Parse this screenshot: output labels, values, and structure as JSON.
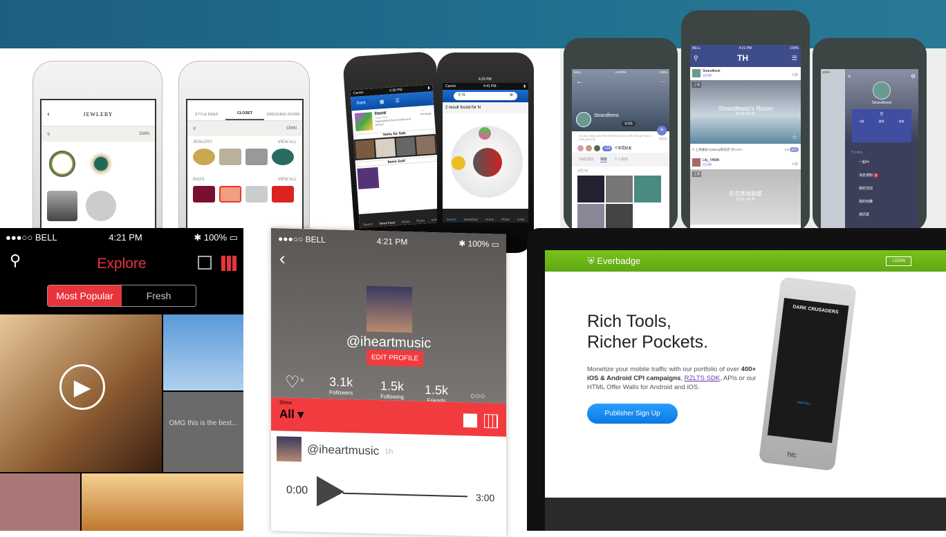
{
  "jewelry_app": {
    "screen1": {
      "title": "JEWLERY",
      "search_filter": "OWN"
    },
    "screen2": {
      "tabs": [
        "STYLE FEED",
        "CLOSET",
        "DRESSING ROOM"
      ],
      "active_tab": "CLOSET",
      "search_filter": "OWN",
      "sections": [
        {
          "label": "JEWLERY",
          "action": "VIEW ALL"
        },
        {
          "label": "BAGS",
          "action": "VIEW ALL"
        }
      ]
    }
  },
  "marketplace_app": {
    "screen1": {
      "carrier": "Carrier",
      "time": "4:36 PM",
      "back": "Back",
      "user_name": "David",
      "user_role": "Sales Rep",
      "user_quote": "Guaranteed best service and prices!",
      "message": "message",
      "items_for_sale": "Items for Sale",
      "items_sold": "Items Sold",
      "tabs": [
        "Search",
        "News Feed",
        "Home",
        "Photo",
        "smily"
      ]
    },
    "screen2": {
      "carrier": "Carrier",
      "time": "4:41 PM",
      "time_outer": "4:25 PM",
      "search_value": "N",
      "result_text": "2 result found for N",
      "tabs": [
        "Search",
        "Newsfeed",
        "Home",
        "Photo",
        "smily"
      ]
    }
  },
  "social_cn_app": {
    "screen1": {
      "carrier": "BELL",
      "time": "4:21PM",
      "battery": "100%",
      "name": "Strandfeest",
      "send_message": "发消息",
      "bio": "As you step over the threshold,you will change into a new person!",
      "add_friend": "加好友",
      "mutual_count": "+24",
      "mutual_label": "个共同好友",
      "tabs": [
        "TA的活动",
        "相册",
        "个人资料"
      ],
      "active_tab": "相册",
      "date": "3月7日"
    },
    "screen2": {
      "carrier": "BELL",
      "time": "4:21 PM",
      "battery": "100%",
      "logo": "TH",
      "posts": [
        {
          "user": "Strandfeest",
          "time": "3分钟",
          "tag": "K歌",
          "city": "上海",
          "room": "Strandfeest's Room",
          "hours": "15:30~21:30",
          "location": "上海嘉城 GalaCity假日店",
          "distance": "距5.9km",
          "count_a": "3",
          "count_b": "5",
          "join": "2人"
        },
        {
          "user": "Lily_YAMA",
          "time": "2分钟",
          "tag": "K歌",
          "city": "上海",
          "room": "失恋阵线联盟",
          "hours": "20:30~00:30"
        }
      ]
    },
    "screen3": {
      "battery": "100%",
      "name": "Strandfeest",
      "quick": [
        "K歌",
        "酒吧",
        "其他"
      ],
      "section": "个人中心",
      "menu": [
        "一起Hi",
        "消息通知",
        "我的活动",
        "我的收藏",
        "通讯录"
      ],
      "badge": "5"
    }
  },
  "explore_app": {
    "carrier": "BELL",
    "time": "4:21 PM",
    "battery": "100%",
    "title": "Explore",
    "segments": [
      "Most Popular",
      "Fresh"
    ],
    "active_segment": "Most Popular",
    "quote": "OMG this is the best...",
    "accent": "#e8343c"
  },
  "profile_app": {
    "carrier": "BELL",
    "time": "4:21 PM",
    "battery": "100%",
    "handle": "@iheartmusic",
    "edit": "EDIT PROFILE",
    "likes_suffix": "'s",
    "stats": [
      {
        "value": "3.1k",
        "label": "Followers"
      },
      {
        "value": "1.5k",
        "label": "Following"
      },
      {
        "value": "1.5k",
        "label": "Friends"
      }
    ],
    "show_label": "Show:",
    "show_value": "All",
    "post_handle": "@iheartmusic",
    "post_age": "1h",
    "time_start": "0:00",
    "time_end": "3:00",
    "accent": "#f23b3f"
  },
  "everbadge": {
    "brand": "Everbadge",
    "login": "LOGIN",
    "headline1": "Rich Tools,",
    "headline2": "Richer Pockets.",
    "body_pre": "Monetize your mobile traffic with our portfolio of over ",
    "body_bold": "400+ iOS & Android CPI campaigns",
    "body_mid": ", ",
    "link": "RZLTS SDK",
    "body_post": ", APIs or our HTML Offer Walls for Android and iOS.",
    "cta": "Publisher Sign Up",
    "device_brand": "htc",
    "game_title": "DARK CRUSADERS",
    "install": "INSTALL",
    "green": "#5fa814",
    "blue": "#1a8cf0"
  }
}
